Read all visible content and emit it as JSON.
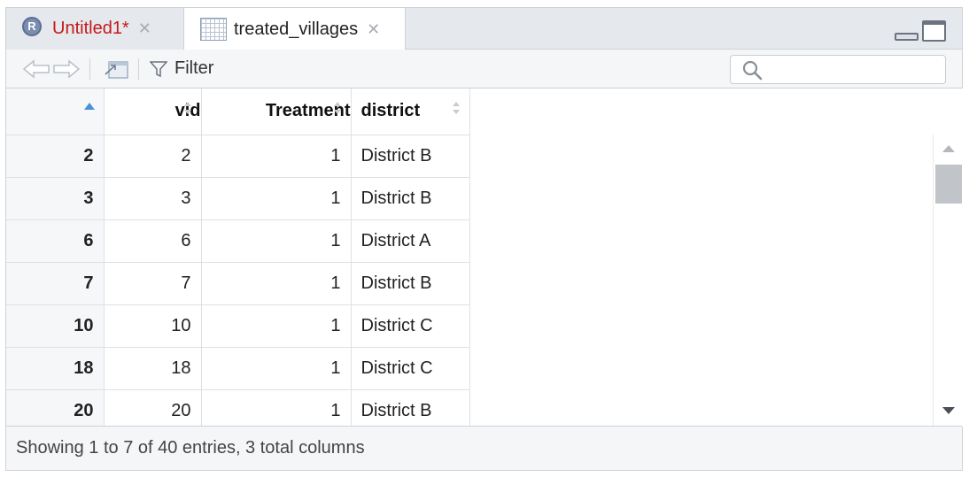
{
  "tabs": [
    {
      "label": "Untitled1*",
      "icon": "r-script-icon",
      "badge": "R",
      "active": false
    },
    {
      "label": "treated_villages",
      "icon": "table-grid-icon",
      "active": true
    }
  ],
  "toolbar": {
    "filter_label": "Filter"
  },
  "search": {
    "value": ""
  },
  "table": {
    "columns": [
      "",
      "vid",
      "Treatment",
      "district"
    ],
    "rows": [
      {
        "row": "2",
        "vid": "2",
        "treatment": "1",
        "district": "District B"
      },
      {
        "row": "3",
        "vid": "3",
        "treatment": "1",
        "district": "District B"
      },
      {
        "row": "6",
        "vid": "6",
        "treatment": "1",
        "district": "District A"
      },
      {
        "row": "7",
        "vid": "7",
        "treatment": "1",
        "district": "District B"
      },
      {
        "row": "10",
        "vid": "10",
        "treatment": "1",
        "district": "District C"
      },
      {
        "row": "18",
        "vid": "18",
        "treatment": "1",
        "district": "District C"
      },
      {
        "row": "20",
        "vid": "20",
        "treatment": "1",
        "district": "District B"
      }
    ]
  },
  "status": {
    "text": "Showing 1 to 7 of 40 entries, 3 total columns"
  },
  "colors": {
    "accent": "#4a90d9",
    "modified_tab": "#c41a1a"
  }
}
